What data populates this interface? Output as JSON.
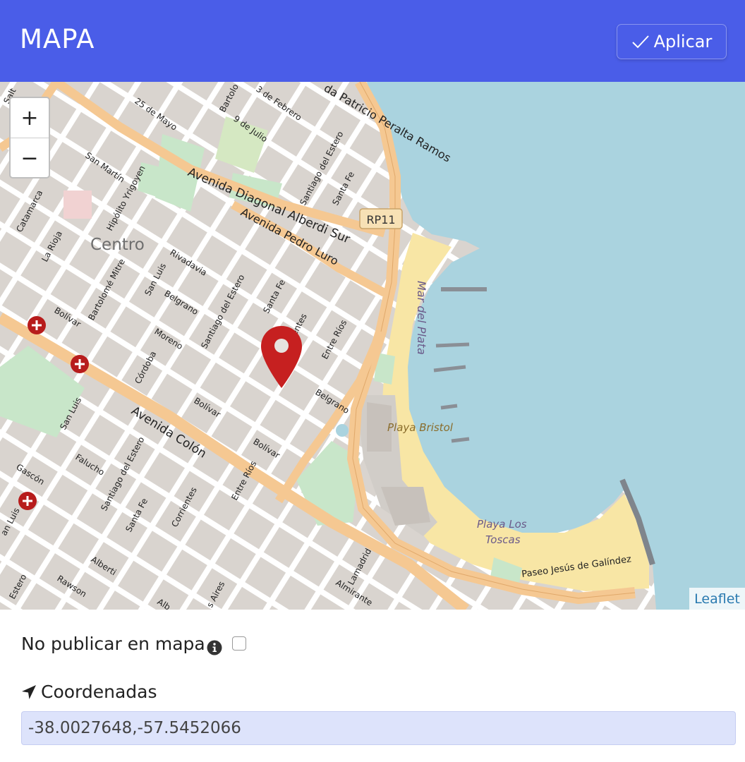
{
  "header": {
    "title": "MAPA",
    "apply_label": "Aplicar",
    "background": "#4a5de8"
  },
  "map": {
    "zoom_in_label": "+",
    "zoom_out_label": "−",
    "attribution": "Leaflet",
    "labels": {
      "centro": "Centro",
      "mar_del_plata": "Mar del Plata",
      "playa_bristol": "Playa Bristol",
      "playa_los": "Playa Los",
      "toscas": "Toscas",
      "rp11": "RP11",
      "av_diagonal": "Avenida Diagonal Alberdi Sur",
      "av_pedro_luro": "Avenida Pedro Luro",
      "av_colon": "Avenida Colón",
      "patricio": "da Patricio Peralta Ramos",
      "paseo": "Paseo Jesús de Galíndez",
      "san_martin": "San Martín",
      "hipolito": "Hipólito Yrigoyen",
      "mitre": "Bartolomé Mitre",
      "san_luis": "San Luis",
      "san_luis_2": "San Luis",
      "cordoba": "Córdoba",
      "santiago": "Santiago del Estero",
      "santiago_2": "Santiago del Estero",
      "santiago_3": "Santiago del Estero",
      "santa_fe": "Santa Fe",
      "santa_fe_2": "Santa Fe",
      "santa_fe_3": "Santa Fe",
      "corrientes": "Corrientes",
      "corrientes_2": "Corrientes",
      "entre_rios": "Entre Ríos",
      "entre_rios_2": "Entre Ríos",
      "rivadavia": "Rivadavia",
      "belgrano": "Belgrano",
      "belgrano_2": "Belgrano",
      "moreno": "Moreno",
      "bolivar": "Bolívar",
      "bolivar_2": "Bolívar",
      "bolivar_3": "Bolívar",
      "catamarca": "Catamarca",
      "la_rioja": "La Rioja",
      "gascon": "Gascón",
      "falucho": "Falucho",
      "alberti": "Alberti",
      "rawson": "Rawson",
      "lamadrid": "Lamadrid",
      "almirante": "Almirante",
      "aires": "s Aires",
      "mayo": "25 de Mayo",
      "julio": "9 de Julio",
      "febrero": "3 de Febrero",
      "bartolo": "Bartolo",
      "estero": "Estero",
      "luis": "an Luis",
      "alb": "Alb",
      "salt": "Salt"
    },
    "colors": {
      "land": "#e0dcd6",
      "water": "#aad3df",
      "beach": "#f8e6a5",
      "park": "#c8e6c9",
      "avenue": "#f5c892",
      "marker": "#c62020"
    }
  },
  "options": {
    "no_publish_label": "No publicar en mapa",
    "no_publish_checked": false
  },
  "coordinates": {
    "label": "Coordenadas",
    "value": "-38.0027648,-57.5452066"
  }
}
